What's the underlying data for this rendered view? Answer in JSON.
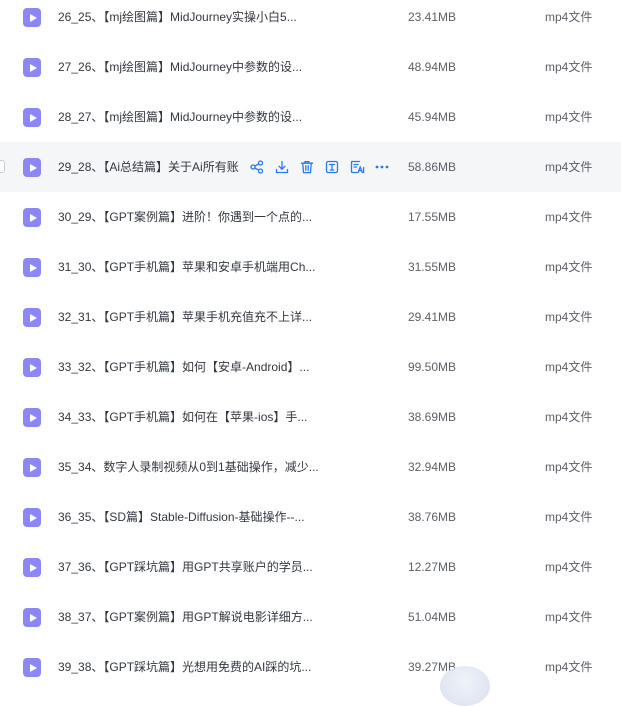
{
  "accent_color": "#2a78f0",
  "file_icon_color": "#8c87f4",
  "files": [
    {
      "name": "26_25、【mj绘图篇】MidJourney实操小白5...",
      "size": "23.41MB",
      "type": "mp4文件"
    },
    {
      "name": "27_26、【mj绘图篇】MidJourney中参数的设...",
      "size": "48.94MB",
      "type": "mp4文件"
    },
    {
      "name": "28_27、【mj绘图篇】MidJourney中参数的设...",
      "size": "45.94MB",
      "type": "mp4文件"
    },
    {
      "name": "29_28、【Ai总结篇】关于Ai所有账",
      "size": "58.86MB",
      "type": "mp4文件",
      "hovered": true
    },
    {
      "name": "30_29、【GPT案例篇】进阶！你遇到一个点的...",
      "size": "17.55MB",
      "type": "mp4文件"
    },
    {
      "name": "31_30、【GPT手机篇】苹果和安卓手机端用Ch...",
      "size": "31.55MB",
      "type": "mp4文件"
    },
    {
      "name": "32_31、【GPT手机篇】苹果手机充值充不上详...",
      "size": "29.41MB",
      "type": "mp4文件"
    },
    {
      "name": "33_32、【GPT手机篇】如何【安卓-Android】...",
      "size": "99.50MB",
      "type": "mp4文件"
    },
    {
      "name": "34_33、【GPT手机篇】如何在【苹果-ios】手...",
      "size": "38.69MB",
      "type": "mp4文件"
    },
    {
      "name": "35_34、数字人录制视频从0到1基础操作，减少...",
      "size": "32.94MB",
      "type": "mp4文件"
    },
    {
      "name": "36_35、【SD篇】Stable-Diffusion-基础操作--...",
      "size": "38.76MB",
      "type": "mp4文件"
    },
    {
      "name": "37_36、【GPT踩坑篇】用GPT共享账户的学员...",
      "size": "12.27MB",
      "type": "mp4文件"
    },
    {
      "name": "38_37、【GPT案例篇】用GPT解说电影详细方...",
      "size": "51.04MB",
      "type": "mp4文件"
    },
    {
      "name": "39_38、【GPT踩坑篇】光想用免费的AI踩的坑...",
      "size": "39.27MB",
      "type": "mp4文件"
    }
  ],
  "hover_actions": [
    {
      "icon": "share-icon"
    },
    {
      "icon": "download-icon"
    },
    {
      "icon": "delete-icon"
    },
    {
      "icon": "text-extract-icon"
    },
    {
      "icon": "ai-summary-icon"
    },
    {
      "icon": "more-icon"
    }
  ]
}
